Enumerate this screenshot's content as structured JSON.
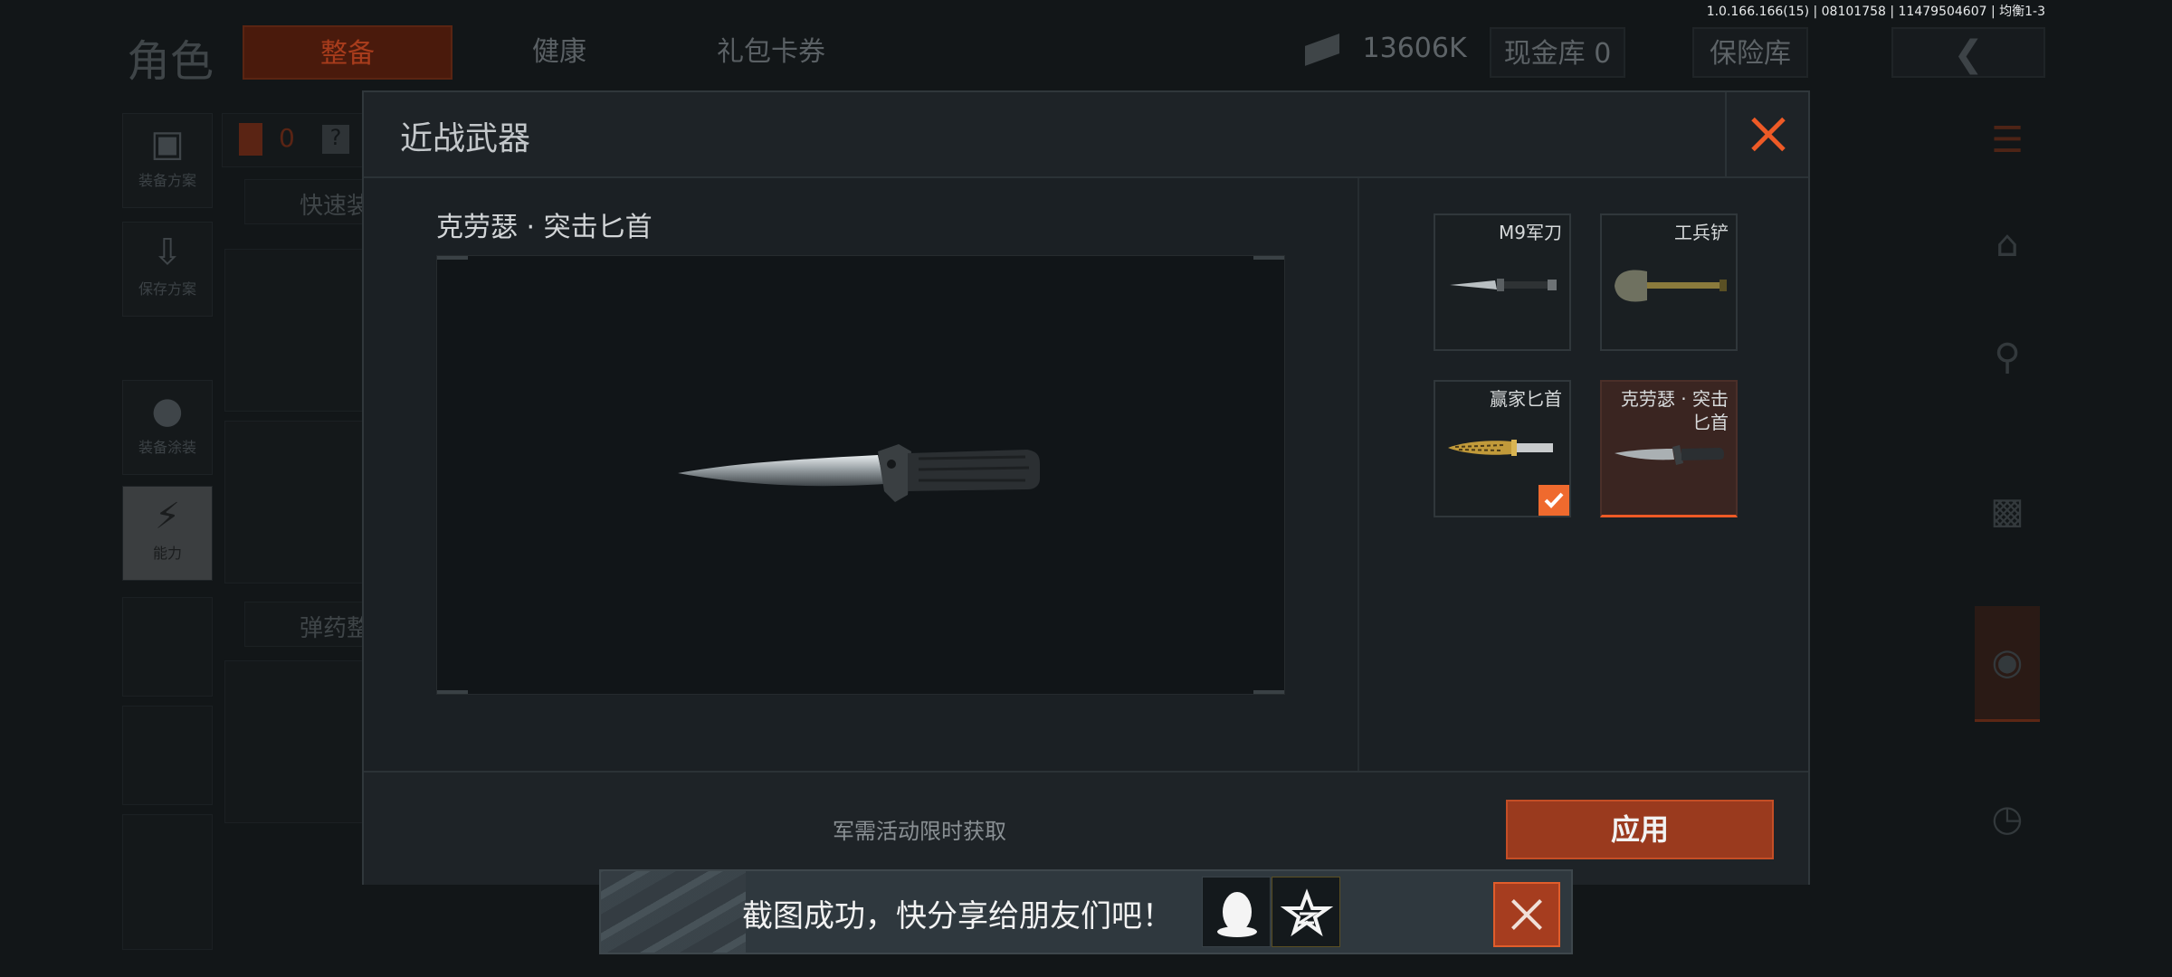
{
  "version": "1.0.166.166(15) | 08101758 | 11479504607 | 均衡1-3",
  "background": {
    "title": "角色",
    "tabs": [
      "整备",
      "健康",
      "礼包卡券"
    ],
    "currency": "13606K",
    "cash_vault": "现金库 0",
    "safe_box": "保险库",
    "counter": "0",
    "left_nav": [
      "装备方案",
      "保存方案",
      "装备涂装",
      "能力"
    ],
    "quick_equip": "快速装",
    "ammo": "弹药整"
  },
  "modal": {
    "title": "近战武器",
    "selected_weapon_name": "克劳瑟 · 突击匕首",
    "weapons": [
      {
        "label": "M9军刀",
        "icon": "bayonet-icon",
        "equipped": false,
        "selected": false
      },
      {
        "label": "工兵铲",
        "icon": "shovel-icon",
        "equipped": false,
        "selected": false
      },
      {
        "label": "赢家匕首",
        "icon": "gold-dagger-icon",
        "equipped": true,
        "selected": false
      },
      {
        "label": "克劳瑟 · 突击匕首",
        "icon": "combat-knife-icon",
        "equipped": false,
        "selected": true
      }
    ],
    "acquire_hint": "军需活动限时获取",
    "apply_label": "应用"
  },
  "toast": {
    "text": "截图成功，快分享给朋友们吧！"
  },
  "colors": {
    "accent": "#ee5a26",
    "apply": "#9a3a1e"
  }
}
